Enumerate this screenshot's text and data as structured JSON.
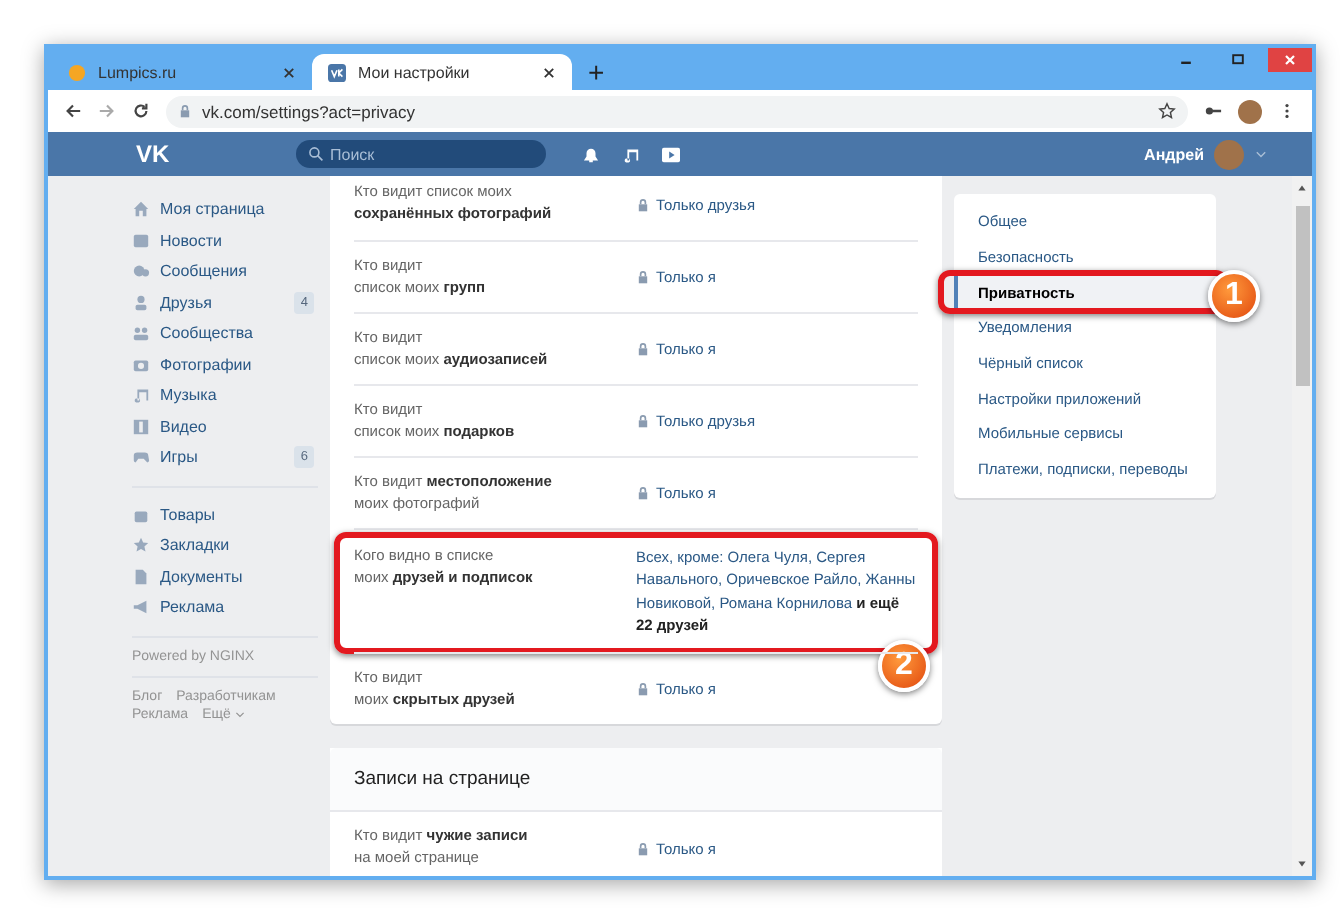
{
  "browser": {
    "tabs": [
      {
        "title": "Lumpics.ru",
        "selected": false
      },
      {
        "title": "Мои настройки",
        "selected": true
      }
    ],
    "new_tab": "+",
    "url": "vk.com/settings?act=privacy"
  },
  "header": {
    "logo": "VK",
    "search_placeholder": "Поиск",
    "user_name": "Андрей"
  },
  "sidebar": {
    "groups": [
      {
        "items": [
          {
            "label": "Моя страница"
          },
          {
            "label": "Новости"
          },
          {
            "label": "Сообщения"
          },
          {
            "label": "Друзья",
            "count": "4"
          },
          {
            "label": "Сообщества"
          },
          {
            "label": "Фотографии"
          },
          {
            "label": "Музыка"
          },
          {
            "label": "Видео"
          },
          {
            "label": "Игры",
            "count": "6"
          }
        ]
      },
      {
        "items": [
          {
            "label": "Товары"
          },
          {
            "label": "Закладки"
          },
          {
            "label": "Документы"
          },
          {
            "label": "Реклама"
          }
        ]
      }
    ],
    "powered_by": "Powered by NGINX",
    "footer_links": [
      "Блог",
      "Разработчикам",
      "Реклама",
      "Ещё"
    ]
  },
  "privacy": {
    "rows": [
      {
        "label": "Кто видит список моих\n**сохранённых фотографий**",
        "kind": "lock",
        "value": "Только друзья"
      },
      {
        "label": "Кто видит\nсписок моих **групп**",
        "kind": "lock",
        "value": "Только я"
      },
      {
        "label": "Кто видит\nсписок моих **аудиозаписей**",
        "kind": "lock",
        "value": "Только я"
      },
      {
        "label": "Кто видит\nсписок моих **подарков**",
        "kind": "lock",
        "value": "Только друзья"
      },
      {
        "label": "Кто видит **местоположение**\nмоих фотографий",
        "kind": "lock",
        "value": "Только я"
      },
      {
        "label": "Кого видно в списке\nмоих **друзей и подписок**",
        "kind": "list",
        "value": "Всех, кроме: Олега Чуля, Сергея Навального, Оричевское Райло, Жанны Новиковой, Романа Корнилова **и ещё 22 друзей**",
        "callout": "2"
      },
      {
        "label": "Кто видит\nмоих **скрытых друзей**",
        "kind": "lock",
        "value": "Только я"
      }
    ]
  },
  "wall": {
    "title": "Записи на странице",
    "rows": [
      {
        "label": "Кто видит **чужие записи**\nна моей странице",
        "kind": "lock",
        "value": "Только я"
      }
    ]
  },
  "settings_menu": {
    "items": [
      {
        "label": "Общее",
        "selected": false
      },
      {
        "label": "Безопасность",
        "selected": false
      },
      {
        "label": "Приватность",
        "selected": true,
        "callout": "1"
      },
      {
        "label": "Уведомления",
        "selected": false
      },
      {
        "label": "Чёрный список",
        "selected": false
      },
      {
        "label": "Настройки приложений",
        "selected": false
      },
      {
        "label": "Мобильные сервисы",
        "selected": false
      },
      {
        "label": "Платежи, подписки, переводы",
        "selected": false
      }
    ]
  }
}
